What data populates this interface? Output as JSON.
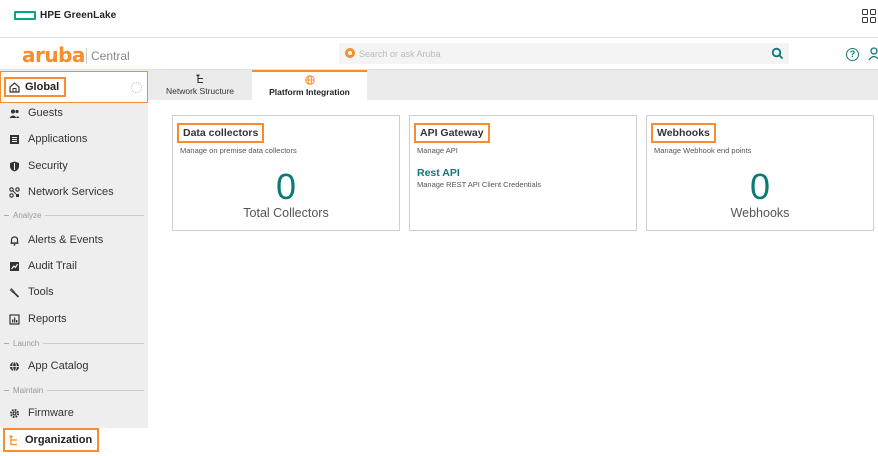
{
  "hpe_bar": {
    "title": "HPE GreenLake"
  },
  "header": {
    "logo": "aruba",
    "product": "Central",
    "search_placeholder": "Search or ask Aruba",
    "help_glyph": "?"
  },
  "sidebar": {
    "global_label": "Global",
    "items": [
      {
        "label": "Guests",
        "icon": "guests-icon"
      },
      {
        "label": "Applications",
        "icon": "applications-icon"
      },
      {
        "label": "Security",
        "icon": "shield-icon"
      },
      {
        "label": "Network Services",
        "icon": "network-services-icon"
      }
    ],
    "section_analyze": "Analyze",
    "analyze_items": [
      {
        "label": "Alerts & Events",
        "icon": "bell-icon"
      },
      {
        "label": "Audit Trail",
        "icon": "audit-icon"
      },
      {
        "label": "Tools",
        "icon": "wrench-icon"
      },
      {
        "label": "Reports",
        "icon": "reports-icon"
      }
    ],
    "section_launch": "Launch",
    "launch_items": [
      {
        "label": "App Catalog",
        "icon": "globe-icon"
      }
    ],
    "section_maintain": "Maintain",
    "maintain_items": [
      {
        "label": "Firmware",
        "icon": "gear-icon"
      }
    ],
    "organization_label": "Organization"
  },
  "tabs": [
    {
      "label": "Network Structure",
      "icon": "hierarchy-icon",
      "active": false
    },
    {
      "label": "Platform Integration",
      "icon": "globe-icon",
      "active": true
    }
  ],
  "cards": {
    "data_collectors": {
      "title": "Data collectors",
      "subtitle": "Manage on premise data collectors",
      "count": "0",
      "count_label": "Total Collectors"
    },
    "api_gateway": {
      "title": "API Gateway",
      "subtitle": "Manage API",
      "link_title": "Rest API",
      "link_subtitle": "Manage REST API Client Credentials"
    },
    "webhooks": {
      "title": "Webhooks",
      "subtitle": "Manage Webhook end points",
      "count": "0",
      "count_label": "Webhooks"
    }
  },
  "colors": {
    "accent_orange": "#f68d2e",
    "teal": "#0b7a75",
    "hpe_green": "#01a982"
  }
}
